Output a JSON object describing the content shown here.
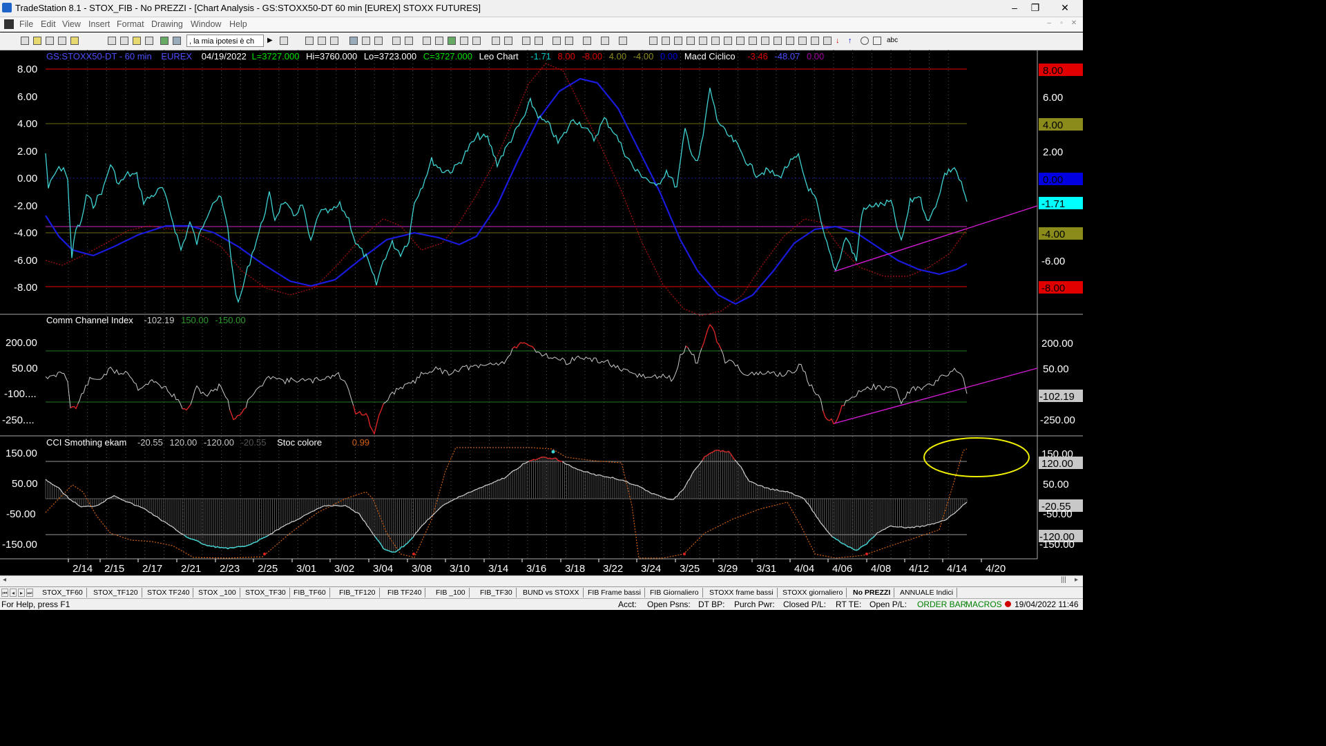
{
  "window": {
    "title": "TradeStation 8.1 - STOX_FIB - No PREZZI - [Chart Analysis - GS:STOXX50-DT  60 min  [EUREX] STOXX FUTURES]",
    "minimize": "–",
    "restore": "❐",
    "close": "✕"
  },
  "menu": [
    "File",
    "Edit",
    "View",
    "Insert",
    "Format",
    "Drawing",
    "Window",
    "Help"
  ],
  "mdi_controls": [
    "–",
    "▫",
    "✕"
  ],
  "toolbar": {
    "combo_value": ", la mia ipotesi è ch",
    "text_tool_label": "abc"
  },
  "panel1": {
    "symbol": "GS:STOXX50-DT - 60 min",
    "exchange": "EUREX",
    "date": "04/19/2022",
    "last": "L=3727.000",
    "high": "Hi=3760.000",
    "low": "Lo=3723.000",
    "close": "C=3727.000",
    "ind1_name": "Leo Chart",
    "ind1_v1": "-1.71",
    "ind1_v2": "8.00",
    "ind1_v3": "-8.00",
    "ind1_v4": "4.00",
    "ind1_v5": "-4.00",
    "ind1_v6": "0.00",
    "ind2_name": "Macd Ciclico",
    "ind2_v1": "-3.46",
    "ind2_v2": "-48.07",
    "ind2_v3": "0.00",
    "y_ticks": [
      "8.00",
      "6.00",
      "4.00",
      "2.00",
      "0.00",
      "-2.00",
      "-4.00",
      "-6.00",
      "-8.00"
    ],
    "right_labels": [
      "8.00",
      "6.00",
      "4.00",
      "2.00",
      "0.00",
      "-1.71",
      "-4.00",
      "-6.00",
      "-8.00"
    ]
  },
  "panel2": {
    "name": "Comm Channel Index",
    "v1": "-102.19",
    "v2": "150.00",
    "v3": "-150.00",
    "y_ticks": [
      "200.00",
      "50.00",
      "-100....",
      "-250...."
    ],
    "right_labels": [
      "200.00",
      "50.00",
      "-102.19",
      "-250.00"
    ]
  },
  "panel3": {
    "name": "CCI Smothing ekam",
    "v1": "-20.55",
    "v2": "120.00",
    "v3": "-120.00",
    "v4": "-20.55",
    "ind2_name": "Stoc colore",
    "ind2_v1": "0.99",
    "y_ticks": [
      "150.00",
      "50.00",
      "-50.00",
      "-150.00"
    ],
    "right_labels": [
      "150.00",
      "120.00",
      "50.00",
      "-20.55",
      "-50.00",
      "-120.00",
      "-150.00"
    ]
  },
  "x_axis": [
    "2/14",
    "2/15",
    "2/17",
    "2/21",
    "2/23",
    "2/25",
    "3/01",
    "3/02",
    "3/04",
    "3/08",
    "3/10",
    "3/14",
    "3/16",
    "3/18",
    "3/22",
    "3/24",
    "3/25",
    "3/29",
    "3/31",
    "4/04",
    "4/06",
    "4/08",
    "4/12",
    "4/14",
    "4/20"
  ],
  "colors": {
    "cyan_line": "#3fd3d3",
    "blue_line": "#1a1adc",
    "red_dots": "#b01010",
    "magenta": "#d21bd2",
    "olive": "#8a8a20",
    "cci_line": "#c8c8c8",
    "yellow_ellipse": "#f0f000",
    "orange_dots": "#d06010",
    "label_red": "#e00000",
    "label_olive": "#8b8b1c",
    "label_blue": "#0000e0",
    "label_cyan": "#00ffff"
  },
  "tabs": [
    "STOX_TF60",
    "STOX_TF120",
    "STOX TF240",
    "STOX _100",
    "STOX_TF30",
    "FIB_TF60",
    "FIB_TF120",
    "FIB TF240",
    "FIB _100",
    "FIB_TF30",
    "BUND vs STOXX",
    "FIB Frame bassi",
    "FIB Giornaliero",
    "STOXX frame bassi",
    "STOXX giornaliero",
    "No PREZZI",
    "ANNUALE Indici"
  ],
  "active_tab": "No PREZZI",
  "status": {
    "help": "For Help, press F1",
    "acct": "Acct:",
    "open_psns": "Open Psns:",
    "dt_bp": "DT BP:",
    "purch_pwr": "Purch Pwr:",
    "closed_pl": "Closed P/L:",
    "rt_te": "RT TE:",
    "open_pl": "Open P/L:",
    "order_bar": "ORDER BAR",
    "macros": "MACROS",
    "datetime": "19/04/2022 11:46"
  }
}
